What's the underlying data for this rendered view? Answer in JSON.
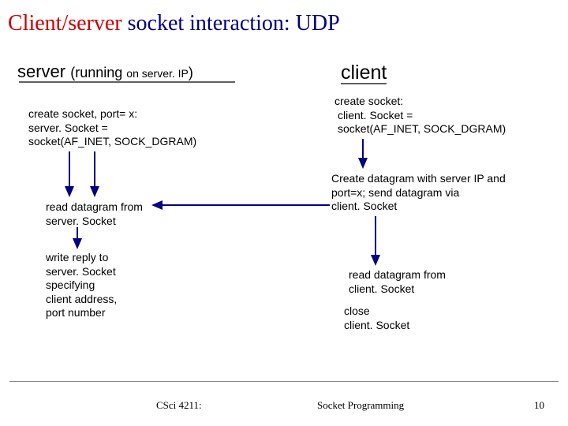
{
  "title": {
    "prefix": "Client/server",
    "rest": " socket interaction: UDP"
  },
  "server": {
    "heading_a": "server ",
    "heading_b": "(running ",
    "heading_c": "on ",
    "heading_d": "server. IP",
    "heading_e": ")",
    "create_l1": "create socket, port= x:",
    "create_l2": "server. Socket =",
    "create_l3": "socket(AF_INET, SOCK_DGRAM)",
    "read_l1": "read datagram from",
    "read_l2": "server. Socket",
    "write_l1": "write reply to",
    "write_l2": "server. Socket",
    "write_l3": "specifying",
    "write_l4": "client address,",
    "write_l5": "port number"
  },
  "client": {
    "heading": "client",
    "create_l1": "create socket:",
    "create_l2": "client. Socket =",
    "create_l3": "socket(AF_INET, SOCK_DGRAM)",
    "send_l1": "Create datagram with server IP and",
    "send_l2": "port=x; send datagram via",
    "send_l3": "client. Socket",
    "read_l1": "read datagram from",
    "read_l2": "client. Socket",
    "close_l1": "close",
    "close_l2": "client. Socket"
  },
  "footer": {
    "course": "CSci 4211:",
    "topic": "Socket Programming",
    "page": "10"
  }
}
